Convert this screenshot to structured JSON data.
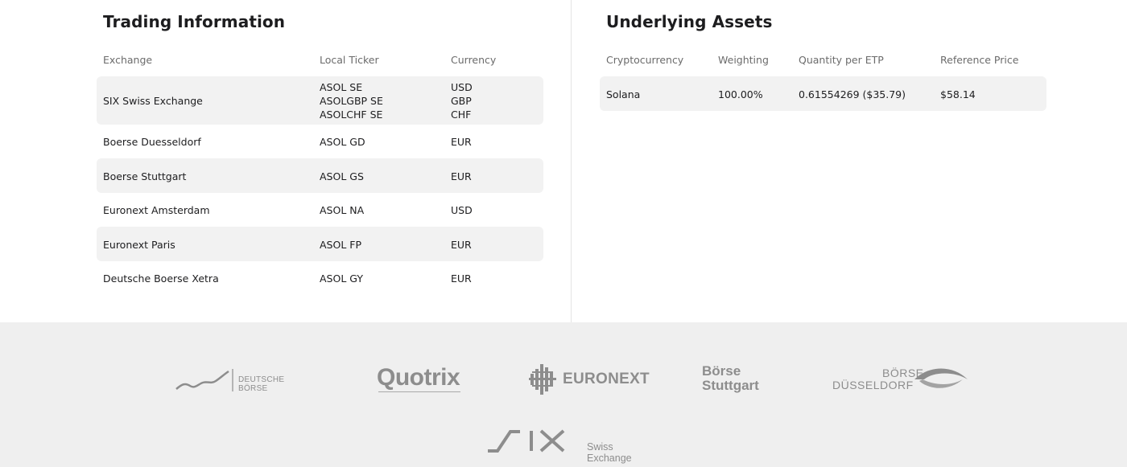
{
  "trading": {
    "title": "Trading Information",
    "headers": {
      "exchange": "Exchange",
      "ticker": "Local Ticker",
      "currency": "Currency"
    },
    "rows": [
      {
        "exchange": "SIX Swiss Exchange",
        "tickers": [
          "ASOL SE",
          "ASOLGBP SE",
          "ASOLCHF SE"
        ],
        "currencies": [
          "USD",
          "GBP",
          "CHF"
        ]
      },
      {
        "exchange": "Boerse Duesseldorf",
        "tickers": [
          "ASOL GD"
        ],
        "currencies": [
          "EUR"
        ]
      },
      {
        "exchange": "Boerse Stuttgart",
        "tickers": [
          "ASOL GS"
        ],
        "currencies": [
          "EUR"
        ]
      },
      {
        "exchange": "Euronext Amsterdam",
        "tickers": [
          "ASOL NA"
        ],
        "currencies": [
          "USD"
        ]
      },
      {
        "exchange": "Euronext Paris",
        "tickers": [
          "ASOL FP"
        ],
        "currencies": [
          "EUR"
        ]
      },
      {
        "exchange": "Deutsche Boerse Xetra",
        "tickers": [
          "ASOL GY"
        ],
        "currencies": [
          "EUR"
        ]
      }
    ]
  },
  "underlying": {
    "title": "Underlying Assets",
    "headers": {
      "crypto": "Cryptocurrency",
      "weighting": "Weighting",
      "quantity": "Quantity per ETP",
      "reference": "Reference Price"
    },
    "rows": [
      {
        "crypto": "Solana",
        "weighting": "100.00%",
        "quantity": "0.61554269 ($35.79)",
        "reference": "$58.14"
      }
    ]
  },
  "logos": {
    "deutsche_boerse": "DEUTSCHE BÖRSE",
    "quotrix": "Quotrix",
    "euronext": "EURONEXT",
    "boerse_stuttgart_1": "Börse",
    "boerse_stuttgart_2": "Stuttgart",
    "boerse_duesseldorf_1": "BÖRSE",
    "boerse_duesseldorf_2": "DÜSSELDORF",
    "six_wordmark": "SIX",
    "six_tagline": "Swiss Exchange"
  }
}
